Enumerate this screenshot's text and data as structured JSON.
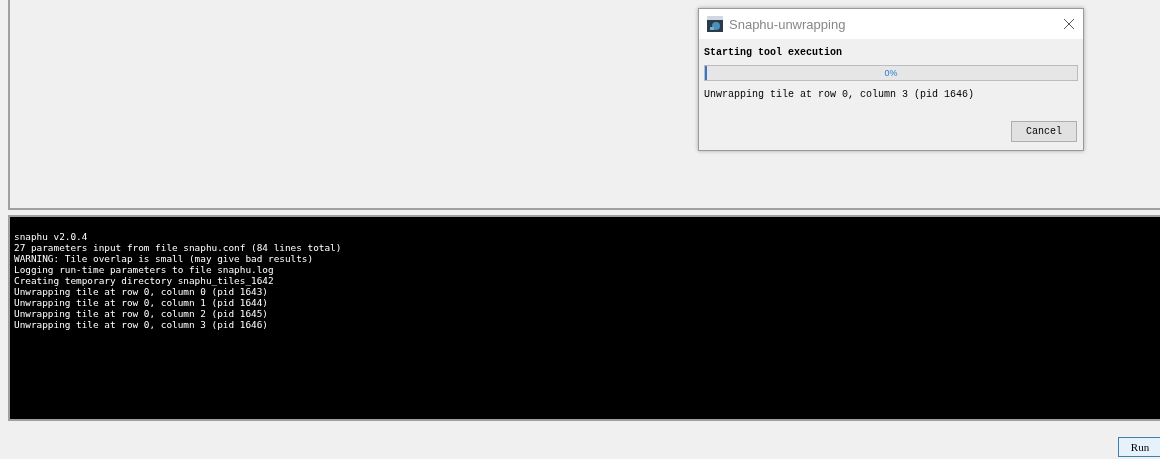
{
  "console": {
    "lines": [
      "snaphu v2.0.4",
      "27 parameters input from file snaphu.conf (84 lines total)",
      "WARNING: Tile overlap is small (may give bad results)",
      "Logging run-time parameters to file snaphu.log",
      "Creating temporary directory snaphu_tiles_1642",
      "Unwrapping tile at row 0, column 0 (pid 1643)",
      "Unwrapping tile at row 0, column 1 (pid 1644)",
      "Unwrapping tile at row 0, column 2 (pid 1645)",
      "Unwrapping tile at row 0, column 3 (pid 1646)"
    ]
  },
  "run_button": "Run",
  "dialog": {
    "title": "Snaphu-unwrapping",
    "heading": "Starting tool execution",
    "progress": {
      "level": 0,
      "reading": "0%"
    },
    "status": "Unwrapping tile at row 0, column 3 (pid 1646)",
    "cancel_button": "Cancel"
  }
}
